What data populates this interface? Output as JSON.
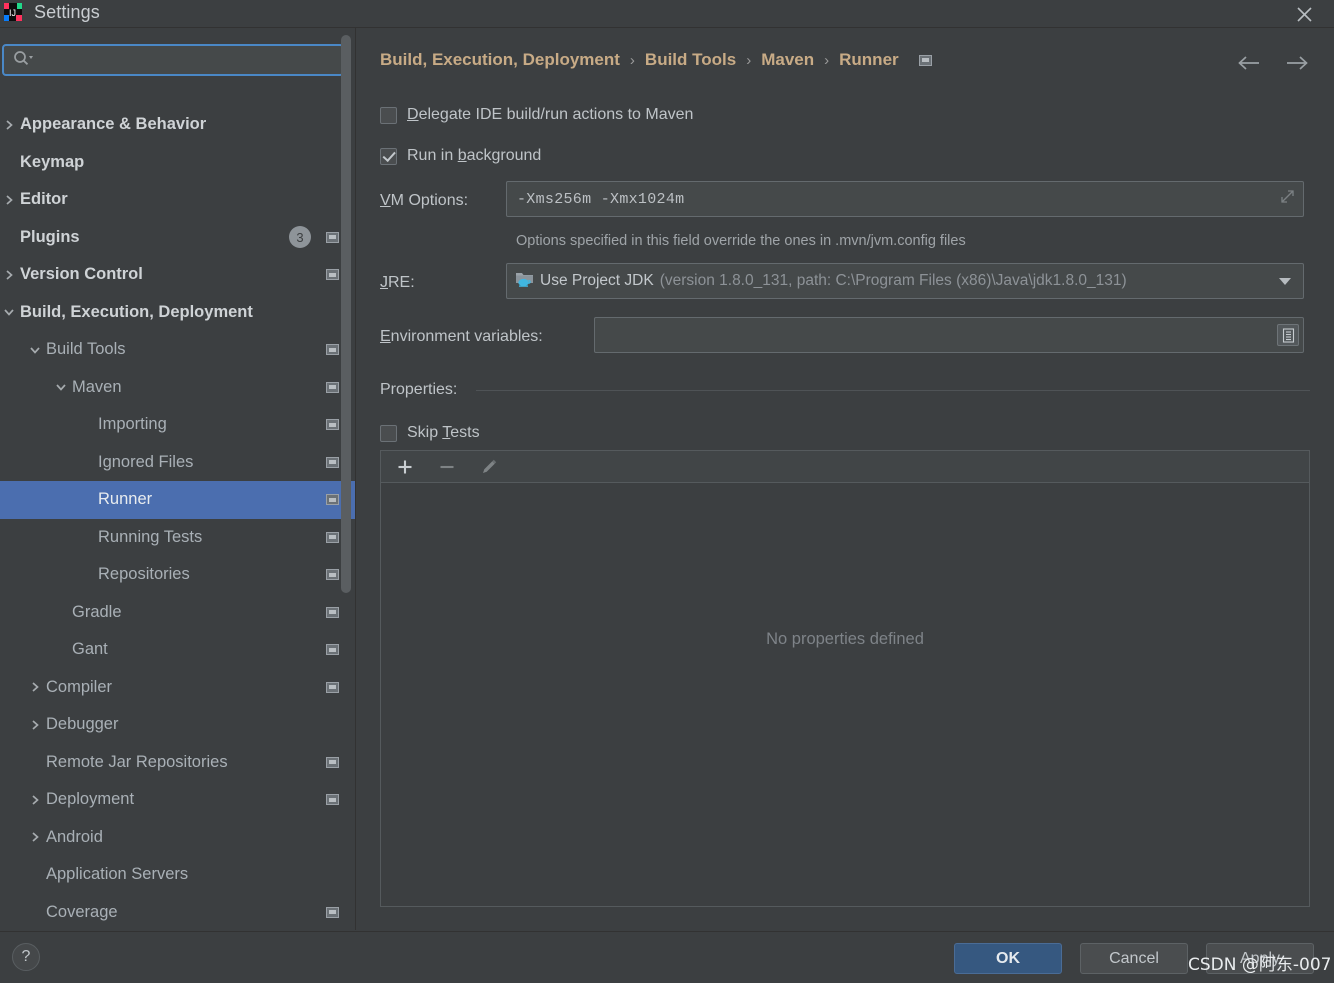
{
  "window": {
    "title": "Settings",
    "close_label": "✕",
    "logo_icon": "intellij-idea-logo-icon"
  },
  "search": {
    "value": "",
    "placeholder": "",
    "icon": "search-icon"
  },
  "sidebar": {
    "items": [
      {
        "label": "Appearance & Behavior",
        "depth": 0,
        "arrow": "right",
        "top": true,
        "cfg": false,
        "badge": null,
        "selected": false
      },
      {
        "label": "Keymap",
        "depth": 0,
        "arrow": "none",
        "top": true,
        "cfg": false,
        "badge": null,
        "selected": false
      },
      {
        "label": "Editor",
        "depth": 0,
        "arrow": "right",
        "top": true,
        "cfg": false,
        "badge": null,
        "selected": false
      },
      {
        "label": "Plugins",
        "depth": 0,
        "arrow": "none",
        "top": true,
        "cfg": true,
        "badge": "3",
        "selected": false
      },
      {
        "label": "Version Control",
        "depth": 0,
        "arrow": "right",
        "top": true,
        "cfg": true,
        "badge": null,
        "selected": false
      },
      {
        "label": "Build, Execution, Deployment",
        "depth": 0,
        "arrow": "down",
        "top": true,
        "cfg": false,
        "badge": null,
        "selected": false
      },
      {
        "label": "Build Tools",
        "depth": 1,
        "arrow": "down",
        "top": false,
        "cfg": true,
        "badge": null,
        "selected": false
      },
      {
        "label": "Maven",
        "depth": 2,
        "arrow": "down",
        "top": false,
        "cfg": true,
        "badge": null,
        "selected": false
      },
      {
        "label": "Importing",
        "depth": 3,
        "arrow": "none",
        "top": false,
        "cfg": true,
        "badge": null,
        "selected": false
      },
      {
        "label": "Ignored Files",
        "depth": 3,
        "arrow": "none",
        "top": false,
        "cfg": true,
        "badge": null,
        "selected": false
      },
      {
        "label": "Runner",
        "depth": 3,
        "arrow": "none",
        "top": false,
        "cfg": true,
        "badge": null,
        "selected": true
      },
      {
        "label": "Running Tests",
        "depth": 3,
        "arrow": "none",
        "top": false,
        "cfg": true,
        "badge": null,
        "selected": false
      },
      {
        "label": "Repositories",
        "depth": 3,
        "arrow": "none",
        "top": false,
        "cfg": true,
        "badge": null,
        "selected": false
      },
      {
        "label": "Gradle",
        "depth": 2,
        "arrow": "none",
        "top": false,
        "cfg": true,
        "badge": null,
        "selected": false
      },
      {
        "label": "Gant",
        "depth": 2,
        "arrow": "none",
        "top": false,
        "cfg": true,
        "badge": null,
        "selected": false
      },
      {
        "label": "Compiler",
        "depth": 1,
        "arrow": "right",
        "top": false,
        "cfg": true,
        "badge": null,
        "selected": false
      },
      {
        "label": "Debugger",
        "depth": 1,
        "arrow": "right",
        "top": false,
        "cfg": false,
        "badge": null,
        "selected": false
      },
      {
        "label": "Remote Jar Repositories",
        "depth": 1,
        "arrow": "none",
        "top": false,
        "cfg": true,
        "badge": null,
        "selected": false
      },
      {
        "label": "Deployment",
        "depth": 1,
        "arrow": "right",
        "top": false,
        "cfg": true,
        "badge": null,
        "selected": false
      },
      {
        "label": "Android",
        "depth": 1,
        "arrow": "right",
        "top": false,
        "cfg": false,
        "badge": null,
        "selected": false
      },
      {
        "label": "Application Servers",
        "depth": 1,
        "arrow": "none",
        "top": false,
        "cfg": false,
        "badge": null,
        "selected": false
      },
      {
        "label": "Coverage",
        "depth": 1,
        "arrow": "none",
        "top": false,
        "cfg": true,
        "badge": null,
        "selected": false
      }
    ]
  },
  "main": {
    "breadcrumb": [
      "Build, Execution, Deployment",
      "Build Tools",
      "Maven",
      "Runner"
    ],
    "breadcrumb_separator": "›",
    "nav_back_icon": "arrow-left-icon",
    "nav_forward_icon": "arrow-right-icon",
    "delegate": {
      "label_before": "",
      "mnemonic": "D",
      "label_after": "elegate IDE build/run actions to Maven",
      "checked": false
    },
    "run_background": {
      "label_before": "Run in ",
      "mnemonic": "b",
      "label_after": "ackground",
      "checked": true
    },
    "vm_options": {
      "label_mnemonic": "V",
      "label_rest": "M Options:",
      "value": "-Xms256m  -Xmx1024m",
      "expand_icon": "expand-diagonal-icon",
      "hint": "Options specified in this field override the ones in .mvn/jvm.config files"
    },
    "jre": {
      "label_mnemonic": "J",
      "label_rest": "RE:",
      "icon": "jdk-folder-java-icon",
      "selected_main": "Use Project JDK",
      "selected_detail": "(version 1.8.0_131, path: C:\\Program Files (x86)\\Java\\jdk1.8.0_131)",
      "caret_icon": "chevron-down-icon"
    },
    "env_vars": {
      "label_mnemonic": "E",
      "label_rest": "nvironment variables:",
      "value": "",
      "browse_icon": "list-browse-icon"
    },
    "properties": {
      "section_label": "Properties:",
      "skip_tests": {
        "label_before": "Skip ",
        "mnemonic": "T",
        "label_after": "ests",
        "checked": false
      },
      "toolbar": [
        {
          "name": "add-property-button",
          "icon": "plus-icon",
          "label": "+",
          "enabled": true
        },
        {
          "name": "remove-property-button",
          "icon": "minus-icon",
          "label": "−",
          "enabled": false
        },
        {
          "name": "edit-property-button",
          "icon": "pencil-icon",
          "label": "",
          "enabled": false
        }
      ],
      "empty_text": "No properties defined"
    }
  },
  "footer": {
    "help_label": "?",
    "ok_label": "OK",
    "cancel_label": "Cancel",
    "apply_label": "Apply"
  },
  "watermark": {
    "text": "CSDN @阿东-007"
  },
  "colors": {
    "accent_selection": "#4b6eaf",
    "ok_button": "#365880",
    "breadcrumb_text": "#c8ab86",
    "panel_bg": "#3c3f41",
    "field_bg": "#45494a",
    "search_focus_border": "#4a88c7"
  }
}
